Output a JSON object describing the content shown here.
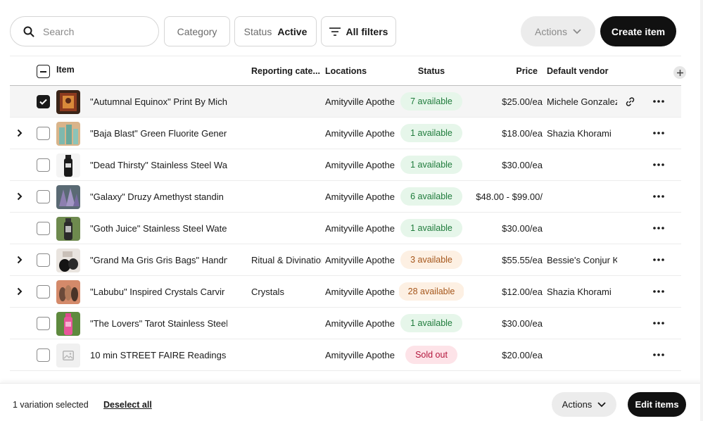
{
  "toolbar": {
    "search_placeholder": "Search",
    "category_label": "Category",
    "status_label": "Status",
    "status_value": "Active",
    "all_filters_label": "All filters",
    "actions_label": "Actions",
    "create_label": "Create item"
  },
  "table": {
    "columns": {
      "item": "Item",
      "category": "Reporting cate...",
      "locations": "Locations",
      "status": "Status",
      "price": "Price",
      "vendor": "Default vendor"
    },
    "rows": [
      {
        "name": "\"Autumnal Equinox\" Print By Mich",
        "category": "",
        "location": "Amityville Apothe",
        "status": "7 available",
        "status_color": "green",
        "price": "$25.00/ea",
        "vendor": "Michele Gonzalez",
        "expandable": false,
        "checked": true,
        "linked": true,
        "thumb": "print"
      },
      {
        "name": "\"Baja Blast\" Green Fluorite Gener",
        "category": "",
        "location": "Amityville Apothe",
        "status": "1 available",
        "status_color": "green",
        "price": "$18.00/ea",
        "vendor": "Shazia Khorami",
        "expandable": true,
        "checked": false,
        "linked": false,
        "thumb": "fluorite"
      },
      {
        "name": "\"Dead Thirsty\" Stainless Steel Wa",
        "category": "",
        "location": "Amityville Apothe",
        "status": "1 available",
        "status_color": "green",
        "price": "$30.00/ea",
        "vendor": "",
        "expandable": false,
        "checked": false,
        "linked": false,
        "thumb": "bottle-black"
      },
      {
        "name": "\"Galaxy\" Druzy Amethyst standin",
        "category": "",
        "location": "Amityville Apothe",
        "status": "6 available",
        "status_color": "green",
        "price": "$48.00 - $99.00/",
        "vendor": "",
        "expandable": true,
        "checked": false,
        "linked": false,
        "thumb": "amethyst"
      },
      {
        "name": "\"Goth Juice\" Stainless Steel Wate",
        "category": "",
        "location": "Amityville Apothe",
        "status": "1 available",
        "status_color": "green",
        "price": "$30.00/ea",
        "vendor": "",
        "expandable": false,
        "checked": false,
        "linked": false,
        "thumb": "bottle-leaf"
      },
      {
        "name": "\"Grand Ma Gris Gris Bags\" Handn",
        "category": "Ritual & Divination",
        "location": "Amityville Apothe",
        "status": "3 available",
        "status_color": "orange",
        "price": "$55.55/ea",
        "vendor": "Bessie's Conjur Ki",
        "expandable": true,
        "checked": false,
        "linked": false,
        "thumb": "bags"
      },
      {
        "name": "\"Labubu\" Inspired Crystals Carvir",
        "category": "Crystals",
        "location": "Amityville Apothe",
        "status": "28 available",
        "status_color": "orange",
        "price": "$12.00/ea",
        "vendor": "Shazia Khorami",
        "expandable": true,
        "checked": false,
        "linked": false,
        "thumb": "crystals"
      },
      {
        "name": "\"The Lovers\" Tarot Stainless Steel",
        "category": "",
        "location": "Amityville Apothe",
        "status": "1 available",
        "status_color": "green",
        "price": "$30.00/ea",
        "vendor": "",
        "expandable": false,
        "checked": false,
        "linked": false,
        "thumb": "bottle-pink"
      },
      {
        "name": "10 min STREET FAIRE Readings",
        "category": "",
        "location": "Amityville Apothe",
        "status": "Sold out",
        "status_color": "red",
        "price": "$20.00/ea",
        "vendor": "",
        "expandable": false,
        "checked": false,
        "linked": false,
        "thumb": "placeholder"
      }
    ]
  },
  "bottom_bar": {
    "selection_text": "1 variation selected",
    "deselect_label": "Deselect all",
    "actions_label": "Actions",
    "edit_label": "Edit items"
  }
}
